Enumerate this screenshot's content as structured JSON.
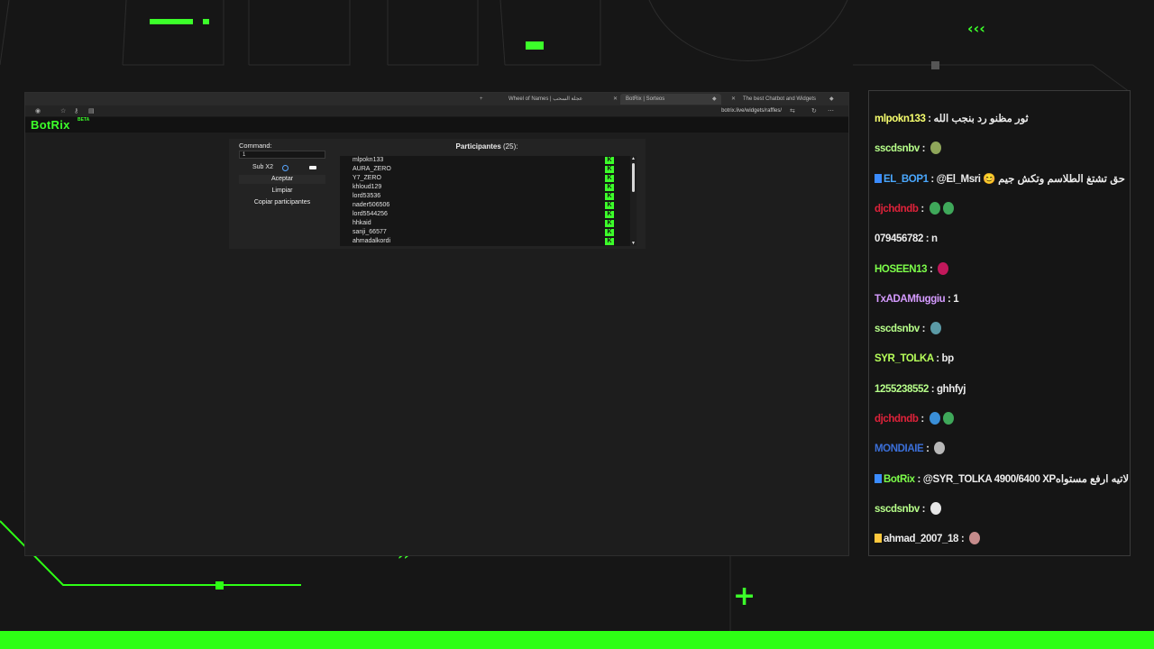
{
  "browser": {
    "tabs": [
      {
        "label": "Wheel of Names | عجلة السحب"
      },
      {
        "label": "BotRix | Sorteos"
      },
      {
        "label": "The best Chatbot and Widgets"
      }
    ],
    "url": "botrix.live/widgets/raffles/"
  },
  "app": {
    "logo": "BotRix",
    "badge": "BETA",
    "command_label": "Command:",
    "command_value": "1",
    "sub_label": "Sub X2",
    "accept_label": "Aceptar",
    "clear_label": "Limpiar",
    "copy_label": "Copiar participantes",
    "participants_title": "Participantes",
    "participants_count": "(25):",
    "kick_icon_letter": "K",
    "participants": [
      "mlpokn133",
      "AURA_ZERO",
      "Y7_ZERO",
      "khloud129",
      "lord53536",
      "nader506506",
      "lord5544256",
      "hhkaid",
      "sanji_66577",
      "ahmadalkordi"
    ]
  },
  "chat": {
    "messages": [
      {
        "user": "mlpokn133",
        "user_color": "#f7ff6e",
        "text": "ثور مظنو رد بنجب الله"
      },
      {
        "user": "sscdsnbv",
        "user_color": "#b7ff8a",
        "text": "",
        "emote": "#8fa65a"
      },
      {
        "user": "EL_BOP1",
        "user_color": "#4aa8ff",
        "badge": "blue",
        "text": "@El_Msri 😊 حق تشتغ الطلاسم وتكش جيم"
      },
      {
        "user": "djchdndb",
        "user_color": "#e0223a",
        "text": "",
        "emote": "#3fa85a",
        "emote2": "#3fa85a"
      },
      {
        "user": "079456782",
        "user_color": "#ececec",
        "text": "n"
      },
      {
        "user": "HOSEEN13",
        "user_color": "#7dff4a",
        "text": "",
        "emote": "#c2185b"
      },
      {
        "user": "TxADAMfuggiu",
        "user_color": "#d59bff",
        "text": "1"
      },
      {
        "user": "sscdsnbv",
        "user_color": "#b7ff8a",
        "text": "",
        "emote": "#5b9aa6"
      },
      {
        "user": "SYR_TOLKA",
        "user_color": "#b7ff5a",
        "text": "bp"
      },
      {
        "user": "1255238552",
        "user_color": "#b7ff8a",
        "text": "ghhfyj"
      },
      {
        "user": "djchdndb",
        "user_color": "#e0223a",
        "text": "",
        "emote": "#3a8fd8",
        "emote2": "#3fa85a"
      },
      {
        "user": "MONDIAIE",
        "user_color": "#3b6fd8",
        "text": "",
        "emote": "#b8b8b8"
      },
      {
        "user": "BotRix",
        "user_color": "#7dff4a",
        "badge": "blue",
        "text": "@SYR_TOLKA 4900/6400 XPلاتيه ارفع مستواه"
      },
      {
        "user": "sscdsnbv",
        "user_color": "#b7ff8a",
        "text": "",
        "emote": "#e6e6e6"
      },
      {
        "user": "ahmad_2007_18",
        "user_color": "#ececec",
        "badge": "gold",
        "text": "",
        "emote": "#c58b8b"
      }
    ]
  },
  "colors": {
    "accent": "#3cff2a",
    "bottom_bar": "#2eff15"
  }
}
